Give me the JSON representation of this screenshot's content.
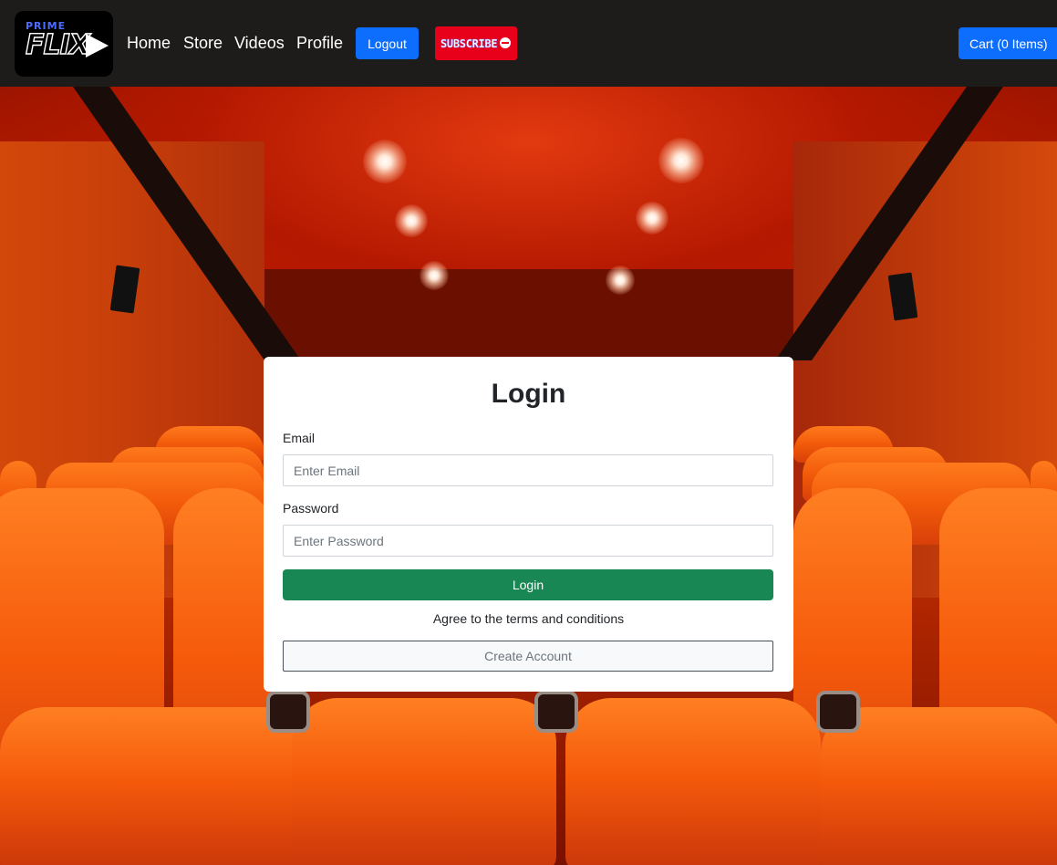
{
  "brand": {
    "top_text": "PRIME",
    "main_text": "FLIX",
    "colors": {
      "prime": "#4d6bff",
      "flix": "#ffffff"
    }
  },
  "nav": {
    "links": [
      "Home",
      "Store",
      "Videos",
      "Profile"
    ],
    "logout_label": "Logout",
    "subscribe_label": "SUBSCRIBE",
    "cart_label": "Cart (0 Items)"
  },
  "login": {
    "title": "Login",
    "email_label": "Email",
    "email_placeholder": "Enter Email",
    "email_value": "",
    "password_label": "Password",
    "password_placeholder": "Enter Password",
    "password_value": "",
    "submit_label": "Login",
    "terms_text": "Agree to the terms and conditions",
    "create_account_label": "Create Account"
  },
  "colors": {
    "navbar_bg": "#1e1b1b",
    "primary": "#0d6efd",
    "success": "#198754",
    "subscribe_red": "#e8001a",
    "card_bg": "#ffffff"
  },
  "background": "cinema-theater-image"
}
